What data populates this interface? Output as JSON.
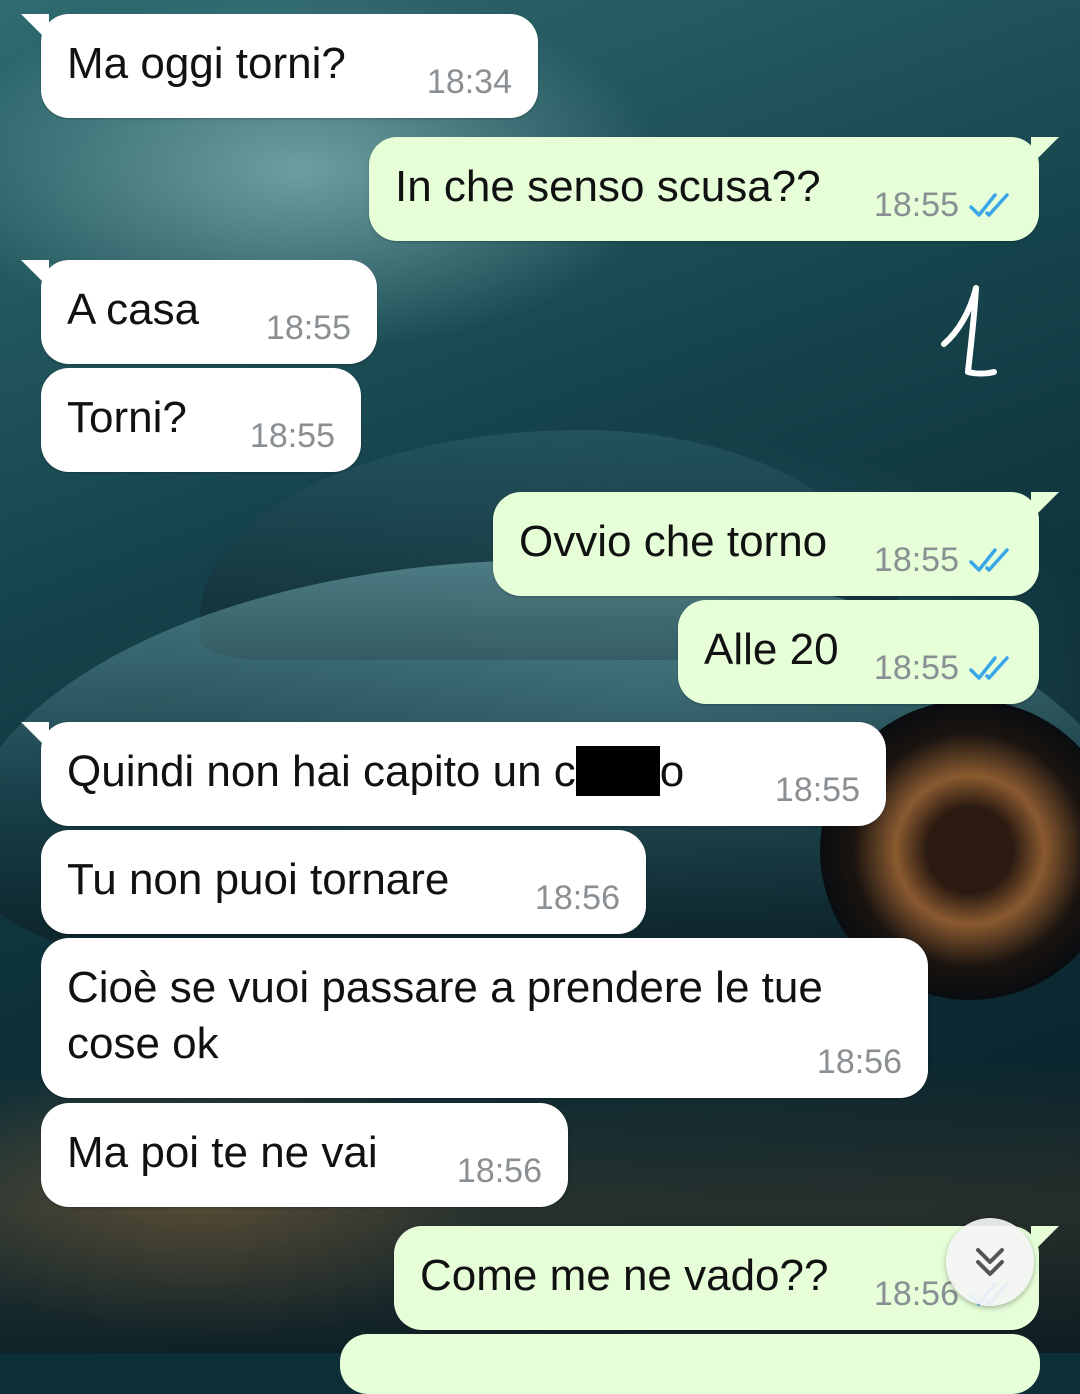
{
  "colors": {
    "incoming": "#ffffff",
    "outgoing": "#e6ffd9",
    "read_ticks": "#3aa6e8",
    "time": "#8a8f93"
  },
  "annotation": "1",
  "messages": [
    {
      "text": "Ma oggi torni?",
      "time": "18:34",
      "direction": "in"
    },
    {
      "text": "In che senso scusa??",
      "time": "18:55",
      "direction": "out",
      "status": "read"
    },
    {
      "text": "A casa",
      "time": "18:55",
      "direction": "in"
    },
    {
      "text": "Torni?",
      "time": "18:55",
      "direction": "in"
    },
    {
      "text": "Ovvio che torno",
      "time": "18:55",
      "direction": "out",
      "status": "read"
    },
    {
      "text": "Alle 20",
      "time": "18:55",
      "direction": "out",
      "status": "read"
    },
    {
      "text_start": "Quindi non hai capito un c",
      "text_end": "o",
      "censored": true,
      "time": "18:55",
      "direction": "in"
    },
    {
      "text": "Tu non puoi tornare",
      "time": "18:56",
      "direction": "in"
    },
    {
      "text": "Cioè se vuoi passare a prendere le tue cose ok",
      "time": "18:56",
      "direction": "in"
    },
    {
      "text": "Ma poi te ne vai",
      "time": "18:56",
      "direction": "in"
    },
    {
      "text": "Come me ne vado??",
      "time": "18:56",
      "direction": "out",
      "status": "read"
    }
  ],
  "scroll_button": {
    "icon": "double-chevron-down-icon"
  }
}
